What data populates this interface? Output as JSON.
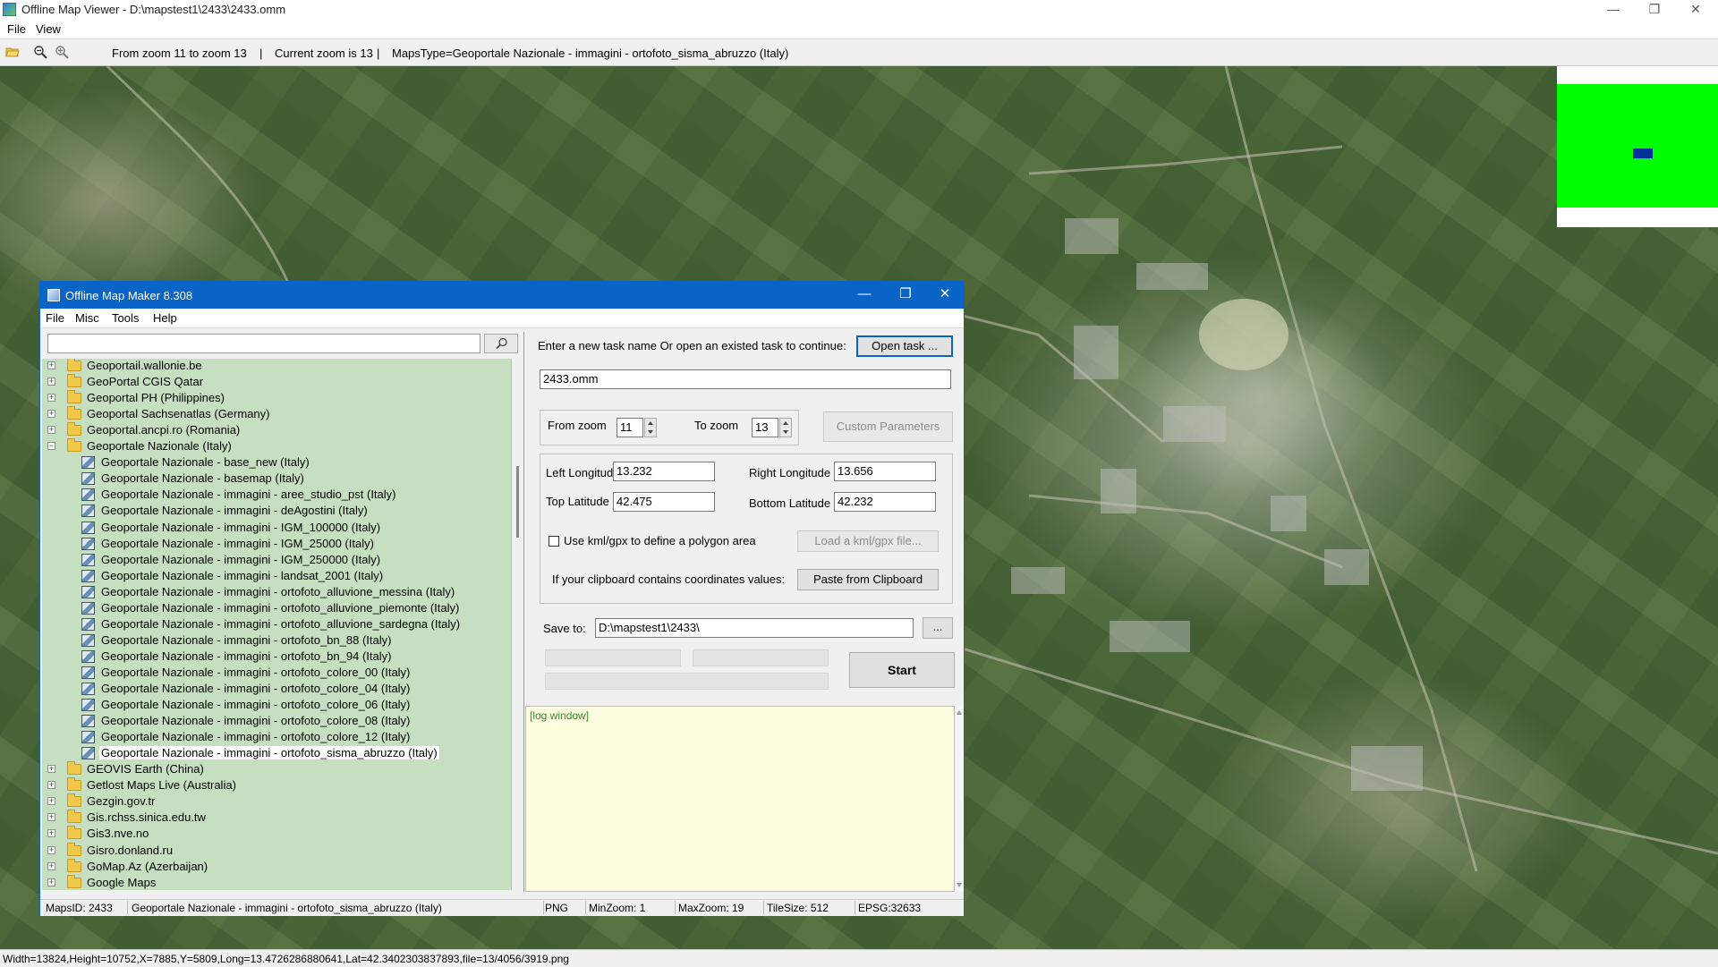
{
  "window": {
    "title": "Offline Map Viewer - D:\\mapstest1\\2433\\2433.omm",
    "minimize": "—",
    "maximize": "❐",
    "close": "✕"
  },
  "menu": {
    "file": "File",
    "view": "View"
  },
  "toolbar": {
    "zoom_range": "From zoom 11 to zoom 13",
    "current_zoom": "Current zoom is 13",
    "maps_type": "MapsType=Geoportale Nazionale - immagini - ortofoto_sisma_abruzzo (Italy)",
    "sep": "|",
    "icons": [
      "open-folder-icon",
      "zoom-out-icon",
      "zoom-in-icon"
    ]
  },
  "overview": {
    "background": "#00ff00",
    "viewport_color": "#003399"
  },
  "statusbar": {
    "text": "Width=13824,Height=10752,X=7885,Y=5809,Long=13.4726286880641,Lat=42.3402303837893,file=13/4056/3919.png"
  },
  "dialog": {
    "title": "Offline Map Maker 8.308",
    "menu": [
      "File",
      "Misc",
      "Tools",
      "Help"
    ],
    "search": {
      "value": "",
      "placeholder": ""
    },
    "tree": [
      {
        "label": "Geoportail.wallonie.be",
        "type": "folder",
        "expander": "+"
      },
      {
        "label": "GeoPortal CGIS Qatar",
        "type": "folder",
        "expander": "+"
      },
      {
        "label": "Geoportal PH (Philippines)",
        "type": "folder",
        "expander": "+"
      },
      {
        "label": "Geoportal Sachsenatlas (Germany)",
        "type": "folder",
        "expander": "+"
      },
      {
        "label": "Geoportal.ancpi.ro (Romania)",
        "type": "folder",
        "expander": "+"
      },
      {
        "label": "Geoportale Nazionale (Italy)",
        "type": "folder",
        "expander": "−"
      },
      {
        "label": "Geoportale Nazionale - base_new (Italy)",
        "type": "map"
      },
      {
        "label": "Geoportale Nazionale - basemap (Italy)",
        "type": "map"
      },
      {
        "label": "Geoportale Nazionale - immagini - aree_studio_pst (Italy)",
        "type": "map"
      },
      {
        "label": "Geoportale Nazionale - immagini - deAgostini (Italy)",
        "type": "map"
      },
      {
        "label": "Geoportale Nazionale - immagini - IGM_100000 (Italy)",
        "type": "map"
      },
      {
        "label": "Geoportale Nazionale - immagini - IGM_25000 (Italy)",
        "type": "map"
      },
      {
        "label": "Geoportale Nazionale - immagini - IGM_250000 (Italy)",
        "type": "map"
      },
      {
        "label": "Geoportale Nazionale - immagini - landsat_2001 (Italy)",
        "type": "map"
      },
      {
        "label": "Geoportale Nazionale - immagini - ortofoto_alluvione_messina (Italy)",
        "type": "map"
      },
      {
        "label": "Geoportale Nazionale - immagini - ortofoto_alluvione_piemonte (Italy)",
        "type": "map"
      },
      {
        "label": "Geoportale Nazionale - immagini - ortofoto_alluvione_sardegna (Italy)",
        "type": "map"
      },
      {
        "label": "Geoportale Nazionale - immagini - ortofoto_bn_88 (Italy)",
        "type": "map"
      },
      {
        "label": "Geoportale Nazionale - immagini - ortofoto_bn_94 (Italy)",
        "type": "map"
      },
      {
        "label": "Geoportale Nazionale - immagini - ortofoto_colore_00 (Italy)",
        "type": "map"
      },
      {
        "label": "Geoportale Nazionale - immagini - ortofoto_colore_04 (Italy)",
        "type": "map"
      },
      {
        "label": "Geoportale Nazionale - immagini - ortofoto_colore_06 (Italy)",
        "type": "map"
      },
      {
        "label": "Geoportale Nazionale - immagini - ortofoto_colore_08 (Italy)",
        "type": "map"
      },
      {
        "label": "Geoportale Nazionale - immagini - ortofoto_colore_12 (Italy)",
        "type": "map"
      },
      {
        "label": "Geoportale Nazionale - immagini - ortofoto_sisma_abruzzo (Italy)",
        "type": "map",
        "selected": true
      },
      {
        "label": "GEOVIS Earth (China)",
        "type": "folder",
        "expander": "+"
      },
      {
        "label": "Getlost Maps Live (Australia)",
        "type": "folder",
        "expander": "+"
      },
      {
        "label": "Gezgin.gov.tr",
        "type": "folder",
        "expander": "+"
      },
      {
        "label": "Gis.rchss.sinica.edu.tw",
        "type": "folder",
        "expander": "+"
      },
      {
        "label": "Gis3.nve.no",
        "type": "folder",
        "expander": "+"
      },
      {
        "label": "Gisro.donland.ru",
        "type": "folder",
        "expander": "+"
      },
      {
        "label": "GoMap.Az (Azerbaijan)",
        "type": "folder",
        "expander": "+"
      },
      {
        "label": "Google Maps",
        "type": "folder",
        "expander": "+"
      }
    ],
    "task": {
      "prompt": "Enter a new task name Or open an existed task to continue:",
      "open_button": "Open task ...",
      "name": "2433.omm"
    },
    "zoom": {
      "from_label": "From zoom",
      "from_value": "11",
      "to_label": "To zoom",
      "to_value": "13",
      "custom_button": "Custom Parameters"
    },
    "coords": {
      "left_label": "Left Longitude",
      "left_value": "13.232",
      "right_label": "Right Longitude",
      "right_value": "13.656",
      "top_label": "Top Latitude",
      "top_value": "42.475",
      "bottom_label": "Bottom Latitude",
      "bottom_value": "42.232",
      "kml_checkbox_label": "Use kml/gpx to define a polygon area",
      "kml_checked": false,
      "kml_button": "Load a kml/gpx file...",
      "clipboard_label": "If your clipboard contains coordinates values:",
      "clipboard_button": "Paste from Clipboard"
    },
    "save": {
      "label": "Save to:",
      "path": "D:\\mapstest1\\2433\\",
      "browse": "..."
    },
    "progress": [
      0,
      0,
      0
    ],
    "start_button": "Start",
    "log": "[log window]",
    "status": {
      "maps_id": "MapsID: 2433",
      "maps_name": "Geoportale Nazionale - immagini - ortofoto_sisma_abruzzo (Italy)",
      "format": "PNG",
      "min_zoom": "MinZoom: 1",
      "max_zoom": "MaxZoom: 19",
      "tile_size": "TileSize: 512",
      "epsg": "EPSG:32633"
    }
  }
}
